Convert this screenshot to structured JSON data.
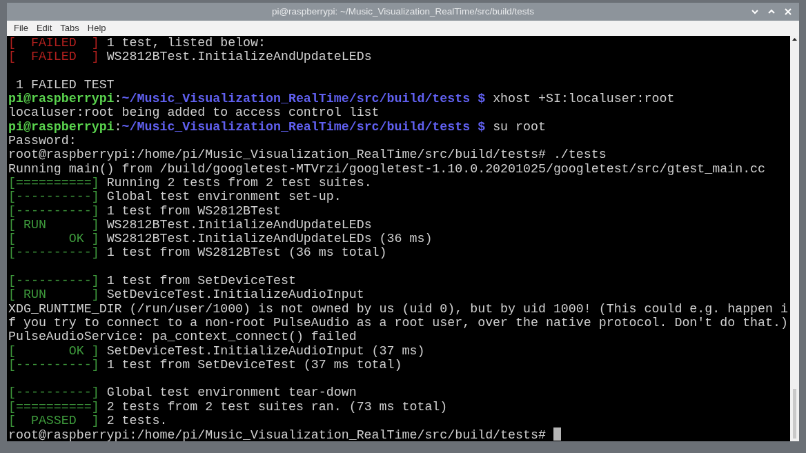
{
  "window": {
    "title": "pi@raspberrypi: ~/Music_Visualization_RealTime/src/build/tests"
  },
  "menu": [
    "File",
    "Edit",
    "Tabs",
    "Help"
  ],
  "terminal": {
    "cursor_visible": true,
    "lines": [
      {
        "segments": [
          {
            "kind": "fail",
            "text": "[  FAILED  ]"
          },
          {
            "kind": "text",
            "text": " 1 test, listed below:"
          }
        ]
      },
      {
        "segments": [
          {
            "kind": "fail",
            "text": "[  FAILED  ]"
          },
          {
            "kind": "text",
            "text": " WS2812BTest.InitializeAndUpdateLEDs"
          }
        ]
      },
      {
        "gap_before": true,
        "segments": [
          {
            "kind": "text",
            "text": " 1 FAILED TEST"
          }
        ]
      },
      {
        "segments": [
          {
            "kind": "user",
            "text": "pi@raspberrypi"
          },
          {
            "kind": "text",
            "text": ":"
          },
          {
            "kind": "path",
            "text": "~/Music_Visualization_RealTime/src/build/tests $"
          },
          {
            "kind": "text",
            "text": " xhost +SI:localuser:root"
          }
        ]
      },
      {
        "segments": [
          {
            "kind": "text",
            "text": "localuser:root being added to access control list"
          }
        ]
      },
      {
        "segments": [
          {
            "kind": "user",
            "text": "pi@raspberrypi"
          },
          {
            "kind": "text",
            "text": ":"
          },
          {
            "kind": "path",
            "text": "~/Music_Visualization_RealTime/src/build/tests $"
          },
          {
            "kind": "text",
            "text": " su root"
          }
        ]
      },
      {
        "segments": [
          {
            "kind": "text",
            "text": "Password:"
          }
        ]
      },
      {
        "segments": [
          {
            "kind": "text",
            "text": "root@raspberrypi:/home/pi/Music_Visualization_RealTime/src/build/tests# ./tests"
          }
        ]
      },
      {
        "segments": [
          {
            "kind": "text",
            "text": "Running main() from /build/googletest-MTVrzi/googletest-1.10.0.20201025/googletest/src/gtest_main.cc"
          }
        ]
      },
      {
        "segments": [
          {
            "kind": "pass",
            "text": "[==========]"
          },
          {
            "kind": "text",
            "text": " Running 2 tests from 2 test suites."
          }
        ]
      },
      {
        "segments": [
          {
            "kind": "pass",
            "text": "[----------]"
          },
          {
            "kind": "text",
            "text": " Global test environment set-up."
          }
        ]
      },
      {
        "segments": [
          {
            "kind": "pass",
            "text": "[----------]"
          },
          {
            "kind": "text",
            "text": " 1 test from WS2812BTest"
          }
        ]
      },
      {
        "segments": [
          {
            "kind": "pass",
            "text": "[ RUN      ]"
          },
          {
            "kind": "text",
            "text": " WS2812BTest.InitializeAndUpdateLEDs"
          }
        ]
      },
      {
        "segments": [
          {
            "kind": "pass",
            "text": "[       OK ]"
          },
          {
            "kind": "text",
            "text": " WS2812BTest.InitializeAndUpdateLEDs (36 ms)"
          }
        ]
      },
      {
        "segments": [
          {
            "kind": "pass",
            "text": "[----------]"
          },
          {
            "kind": "text",
            "text": " 1 test from WS2812BTest (36 ms total)"
          }
        ]
      },
      {
        "gap_before": true,
        "segments": [
          {
            "kind": "pass",
            "text": "[----------]"
          },
          {
            "kind": "text",
            "text": " 1 test from SetDeviceTest"
          }
        ]
      },
      {
        "segments": [
          {
            "kind": "pass",
            "text": "[ RUN      ]"
          },
          {
            "kind": "text",
            "text": " SetDeviceTest.InitializeAudioInput"
          }
        ]
      },
      {
        "segments": [
          {
            "kind": "text",
            "text": "XDG_RUNTIME_DIR (/run/user/1000) is not owned by us (uid 0), but by uid 1000! (This could e.g. happen i"
          }
        ]
      },
      {
        "segments": [
          {
            "kind": "text",
            "text": "f you try to connect to a non-root PulseAudio as a root user, over the native protocol. Don't do that.)"
          }
        ]
      },
      {
        "segments": [
          {
            "kind": "text",
            "text": "PulseAudioService: pa_context_connect() failed"
          }
        ]
      },
      {
        "segments": [
          {
            "kind": "pass",
            "text": "[       OK ]"
          },
          {
            "kind": "text",
            "text": " SetDeviceTest.InitializeAudioInput (37 ms)"
          }
        ]
      },
      {
        "segments": [
          {
            "kind": "pass",
            "text": "[----------]"
          },
          {
            "kind": "text",
            "text": " 1 test from SetDeviceTest (37 ms total)"
          }
        ]
      },
      {
        "gap_before": true,
        "segments": [
          {
            "kind": "pass",
            "text": "[----------]"
          },
          {
            "kind": "text",
            "text": " Global test environment tear-down"
          }
        ]
      },
      {
        "segments": [
          {
            "kind": "pass",
            "text": "[==========]"
          },
          {
            "kind": "text",
            "text": " 2 tests from 2 test suites ran. (73 ms total)"
          }
        ]
      },
      {
        "segments": [
          {
            "kind": "pass",
            "text": "[  PASSED  ]"
          },
          {
            "kind": "text",
            "text": " 2 tests."
          }
        ]
      },
      {
        "segments": [
          {
            "kind": "text",
            "text": "root@raspberrypi:/home/pi/Music_Visualization_RealTime/src/build/tests# "
          }
        ]
      }
    ]
  }
}
